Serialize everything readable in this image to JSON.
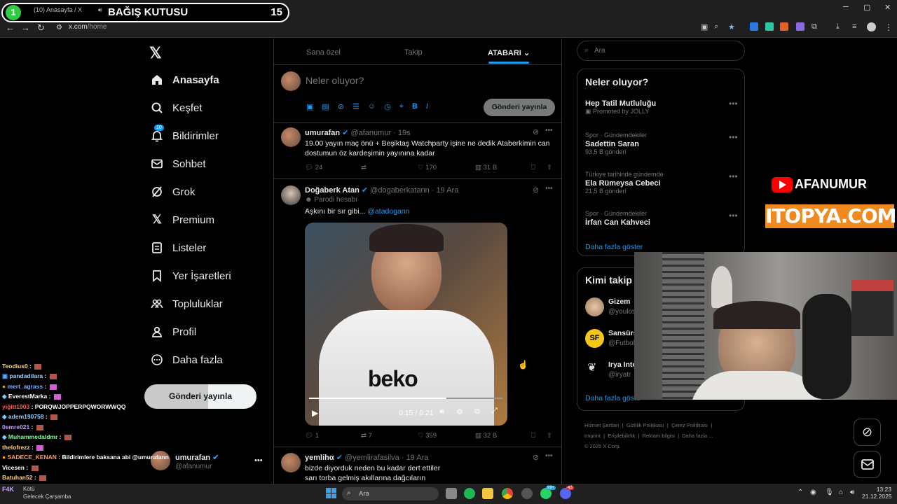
{
  "overlay": {
    "donation_badge": "1",
    "donation_title": "BAĞIŞ KUTUSU",
    "donation_count": "15",
    "tab_title": "(10) Anasayfa / X",
    "channel_name": "AFANUMUR",
    "sponsor": "ITOPYA.COM"
  },
  "browser": {
    "url_host": "x.com",
    "url_path": "/home"
  },
  "sidebar": {
    "items": [
      {
        "label": "Anasayfa",
        "icon": "home-icon"
      },
      {
        "label": "Keşfet",
        "icon": "search-icon"
      },
      {
        "label": "Bildirimler",
        "icon": "bell-icon",
        "badge": "10"
      },
      {
        "label": "Sohbet",
        "icon": "mail-icon"
      },
      {
        "label": "Grok",
        "icon": "grok-icon"
      },
      {
        "label": "Premium",
        "icon": "x-logo-icon"
      },
      {
        "label": "Listeler",
        "icon": "list-icon"
      },
      {
        "label": "Yer İşaretleri",
        "icon": "bookmark-icon"
      },
      {
        "label": "Topluluklar",
        "icon": "people-icon"
      },
      {
        "label": "Profil",
        "icon": "person-icon"
      },
      {
        "label": "Daha fazla",
        "icon": "more-circle-icon"
      }
    ],
    "post_button": "Gönderi yayınla",
    "account_name": "umurafan",
    "account_handle": "@afanumur"
  },
  "timeline": {
    "tabs": [
      "Sana özel",
      "Takip",
      "ATABARI"
    ],
    "compose_placeholder": "Neler oluyor?",
    "compose_button": "Gönderi yayınla",
    "tweets": [
      {
        "name": "umurafan",
        "handle": "@afanumur",
        "time": "19s",
        "text_line1": "19.00 yayın maç önü + Beşiktaş Watchparty işine ne dedik Ataberkimin can",
        "text_line2": "dostumun öz kardeşimin yayınına kadar",
        "replies": "24",
        "likes": "170",
        "views": "31 B"
      },
      {
        "name": "Doğaberk Atan",
        "handle": "@dogaberkatann",
        "time": "19 Ara",
        "label": "Parodi hesabı",
        "text": "Aşkını bir sır gibi...",
        "mention": "@atadogann",
        "video_time": "0:15 / 0:21",
        "video_progress": 0.71,
        "jersey_text": "beko",
        "replies": "1",
        "retweets": "7",
        "likes": "359",
        "views": "32 B"
      },
      {
        "name": "yemlihα",
        "handle": "@yemlirafasilva",
        "time": "19 Ara",
        "text_line1": "bizde diyorduk neden bu kadar dert ettiler",
        "text_line2": "sarı torba gelmiş akıllarına dağcıların"
      }
    ]
  },
  "right": {
    "search_placeholder": "Ara",
    "trends_title": "Neler oluyor?",
    "trends": [
      {
        "context": "",
        "title": "Hep Tatil Mutluluğu",
        "meta": "Promoted by JOLLY"
      },
      {
        "context": "Spor · Gündemdekiler",
        "title": "Sadettin Saran",
        "meta": "93,5 B gönderi"
      },
      {
        "context": "Türkiye tarihinde gündemde",
        "title": "Ela Rümeysa Cebeci",
        "meta": "21,5 B gönderi"
      },
      {
        "context": "Spor · Gündemdekiler",
        "title": "İrfan Can Kahveci",
        "meta": ""
      }
    ],
    "show_more": "Daha fazla göster",
    "follow_title": "Kimi takip",
    "follow": [
      {
        "name": "Gizem",
        "handle": "@youlos"
      },
      {
        "name": "Sansürs",
        "handle": "@Futbol"
      },
      {
        "name": "Irya Inte",
        "handle": "@iryatr"
      }
    ],
    "follow_more": "Daha fazla göste",
    "footer": [
      "Hizmet Şartları",
      "Gizlilik Politikası",
      "Çerez Politikası",
      "Imprint",
      "Erişilebilirlik",
      "Reklam bilgisi",
      "Daha fazla ...",
      "© 2025 X Corp."
    ]
  },
  "chat": [
    {
      "user": "Teodius0",
      "msg": "",
      "color": "#ffd27f"
    },
    {
      "user": "pandadilara",
      "msg": "",
      "color": "#9ad0ff"
    },
    {
      "user": "mert_agrass",
      "msg": "",
      "color": "#7fb2ff"
    },
    {
      "user": "EverestMarka",
      "msg": "",
      "color": "#ffffff"
    },
    {
      "user": "yiğitt1903",
      "msg": "PORQWJOPPERPQWORWWQQ",
      "color": "#ff5a5a"
    },
    {
      "user": "adem190758",
      "msg": "",
      "color": "#9ad0ff"
    },
    {
      "user": "0emre021",
      "msg": "",
      "color": "#c8a0ff"
    },
    {
      "user": "Muhammedaldmr",
      "msg": "",
      "color": "#7fff9a"
    },
    {
      "user": "thelofrezz",
      "msg": "",
      "color": "#ffd27f"
    },
    {
      "user": "SADECE_KENAN",
      "msg": "Bildirimlere baksana abi @umurafann",
      "color": "#ff9a5a"
    },
    {
      "user": "Vicesen",
      "msg": "",
      "color": "#ffffff"
    },
    {
      "user": "Batuhan52",
      "msg": "",
      "color": "#ffd27f"
    }
  ],
  "weather": {
    "temp": "F4K",
    "desc": "Kötü",
    "sub": "Gelecek Çarşamba"
  },
  "taskbar": {
    "search": "Ara",
    "time": "13:23",
    "date": "21.12.2025",
    "badge1": "99+",
    "badge2": "43"
  },
  "floating": {
    "grok": "grok-icon",
    "messages": "mail-icon"
  }
}
